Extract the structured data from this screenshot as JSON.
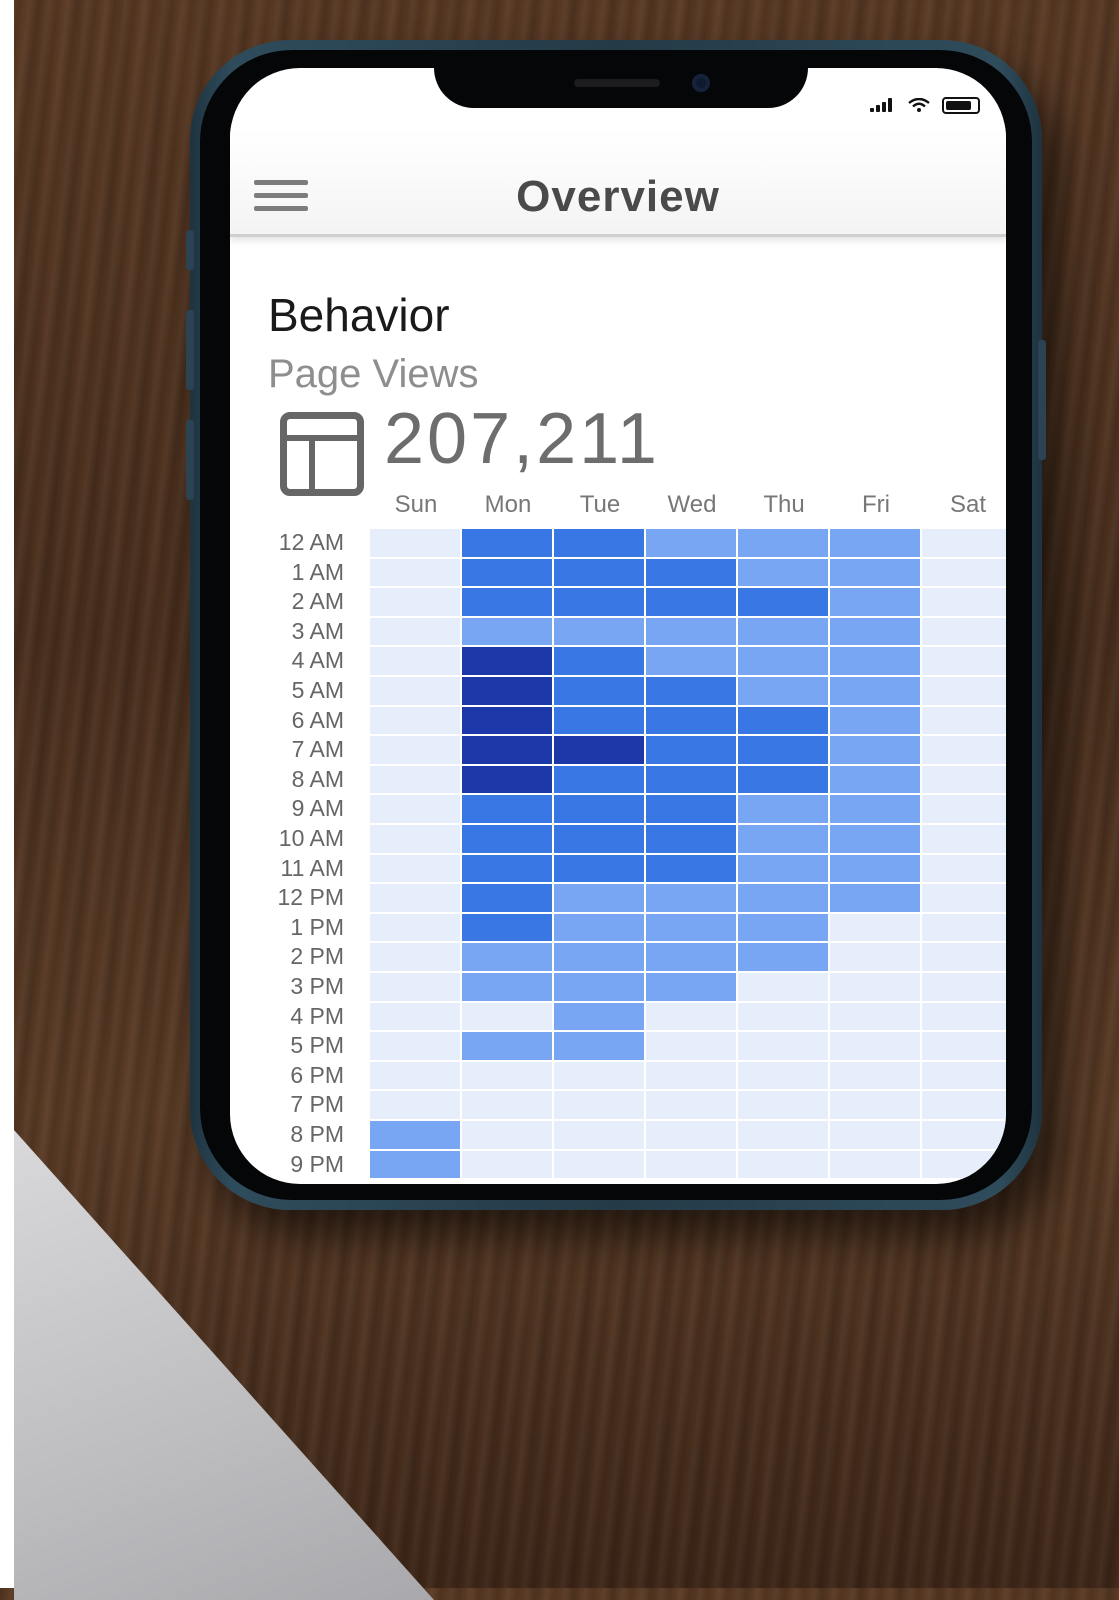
{
  "navbar": {
    "title": "Overview",
    "menu_icon": "hamburger-menu-icon"
  },
  "status_bar": {
    "signal_icon": "cellular-signal-icon",
    "wifi_icon": "wifi-icon",
    "battery_icon": "battery-icon"
  },
  "behavior": {
    "section_title": "Behavior",
    "metric_label": "Page Views",
    "metric_icon": "layout-panel-icon",
    "metric_value": "207,211"
  },
  "chart_data": {
    "type": "heatmap",
    "title": "",
    "x_labels": [
      "Sun",
      "Mon",
      "Tue",
      "Wed",
      "Thu",
      "Fri",
      "Sat"
    ],
    "y_labels": [
      "12 AM",
      "1 AM",
      "2 AM",
      "3 AM",
      "4 AM",
      "5 AM",
      "6 AM",
      "7 AM",
      "8 AM",
      "9 AM",
      "10 AM",
      "11 AM",
      "12 PM",
      "1 PM",
      "2 PM",
      "3 PM",
      "4 PM",
      "5 PM",
      "6 PM",
      "7 PM",
      "8 PM",
      "9 PM"
    ],
    "intensity_scale": [
      0,
      1,
      2,
      3
    ],
    "colors": [
      "#e6eefc",
      "#78a6f2",
      "#3978e4",
      "#1c37a8"
    ],
    "values": [
      [
        0,
        2,
        2,
        1,
        1,
        1,
        0
      ],
      [
        0,
        2,
        2,
        2,
        1,
        1,
        0
      ],
      [
        0,
        2,
        2,
        2,
        2,
        1,
        0
      ],
      [
        0,
        1,
        1,
        1,
        1,
        1,
        0
      ],
      [
        0,
        3,
        2,
        1,
        1,
        1,
        0
      ],
      [
        0,
        3,
        2,
        2,
        1,
        1,
        0
      ],
      [
        0,
        3,
        2,
        2,
        2,
        1,
        0
      ],
      [
        0,
        3,
        3,
        2,
        2,
        1,
        0
      ],
      [
        0,
        3,
        2,
        2,
        2,
        1,
        0
      ],
      [
        0,
        2,
        2,
        2,
        1,
        1,
        0
      ],
      [
        0,
        2,
        2,
        2,
        1,
        1,
        0
      ],
      [
        0,
        2,
        2,
        2,
        1,
        1,
        0
      ],
      [
        0,
        2,
        1,
        1,
        1,
        1,
        0
      ],
      [
        0,
        2,
        1,
        1,
        1,
        0,
        0
      ],
      [
        0,
        1,
        1,
        1,
        1,
        0,
        0
      ],
      [
        0,
        1,
        1,
        1,
        0,
        0,
        0
      ],
      [
        0,
        0,
        1,
        0,
        0,
        0,
        0
      ],
      [
        0,
        1,
        1,
        0,
        0,
        0,
        0
      ],
      [
        0,
        0,
        0,
        0,
        0,
        0,
        0
      ],
      [
        0,
        0,
        0,
        0,
        0,
        0,
        0
      ],
      [
        1,
        0,
        0,
        0,
        0,
        0,
        0
      ],
      [
        1,
        0,
        0,
        0,
        0,
        0,
        0
      ]
    ]
  }
}
